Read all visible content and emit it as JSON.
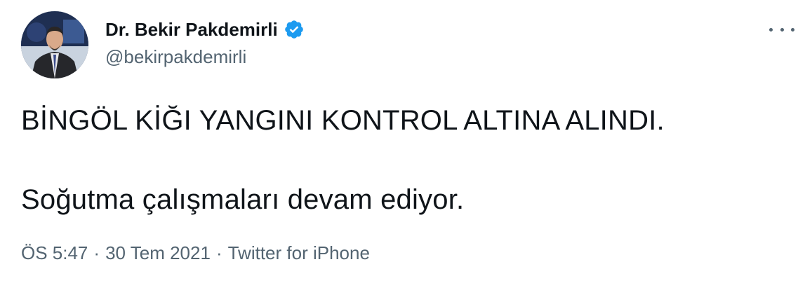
{
  "author": {
    "display_name": "Dr. Bekir Pakdemirli",
    "handle": "@bekirpakdemirli",
    "verified": true,
    "avatar_icon": "profile-photo"
  },
  "tweet": {
    "lines": [
      "BİNGÖL KİĞI YANGINI KONTROL ALTINA ALINDI.",
      "Soğutma çalışmaları devam ediyor."
    ]
  },
  "meta": {
    "time": "ÖS 5:47",
    "separator": "·",
    "date": "30 Tem 2021",
    "source": "Twitter for iPhone"
  },
  "colors": {
    "text": "#0f1419",
    "secondary": "#536471",
    "verified_badge": "#1d9bf0",
    "background": "#ffffff"
  },
  "icons": {
    "more": "more-horizontal-icon",
    "verified": "verified-badge-icon"
  }
}
